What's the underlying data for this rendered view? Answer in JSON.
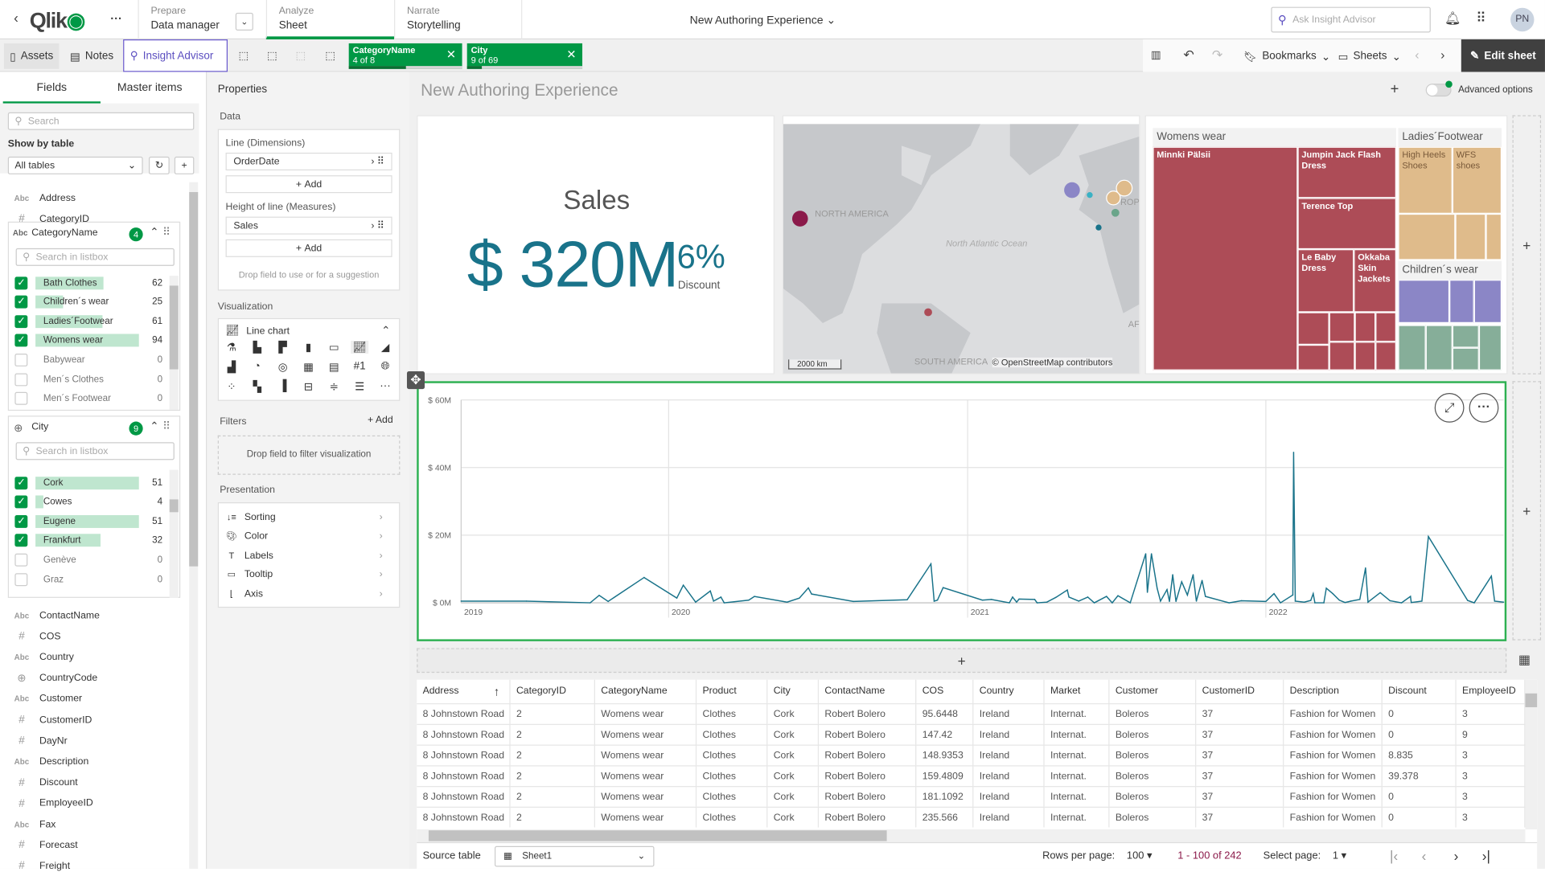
{
  "topbar": {
    "logo": "Qlik",
    "more": "···",
    "prepare": {
      "label": "Prepare",
      "value": "Data manager"
    },
    "analyze": {
      "label": "Analyze",
      "value": "Sheet"
    },
    "narrate": {
      "label": "Narrate",
      "value": "Storytelling"
    },
    "app_title": "New Authoring Experience",
    "search_placeholder": "Ask Insight Advisor",
    "avatar": "PN"
  },
  "toolbar": {
    "assets": "Assets",
    "notes": "Notes",
    "insight_advisor": "Insight Advisor",
    "selections": [
      {
        "field": "CategoryName",
        "count": "4 of 8",
        "fraction": 0.5
      },
      {
        "field": "City",
        "count": "9 of 69",
        "fraction": 0.13
      }
    ],
    "bookmarks": "Bookmarks",
    "sheets": "Sheets",
    "edit_sheet": "Edit sheet"
  },
  "left": {
    "tabs": [
      "Fields",
      "Master items"
    ],
    "search_placeholder": "Search",
    "show_by_table": "Show by table",
    "table_select": "All tables",
    "fields_top": [
      {
        "type": "Abc",
        "name": "Address"
      },
      {
        "type": "#",
        "name": "CategoryID"
      }
    ],
    "listbox_category": {
      "type": "Abc",
      "name": "CategoryName",
      "badge": "4",
      "search_placeholder": "Search in listbox",
      "items": [
        {
          "name": "Bath Clothes",
          "count": "62",
          "selected": true,
          "share": 0.66
        },
        {
          "name": "Children´s wear",
          "count": "25",
          "selected": true,
          "share": 0.27
        },
        {
          "name": "Ladies´Footwear",
          "count": "61",
          "selected": true,
          "share": 0.65
        },
        {
          "name": "Womens wear",
          "count": "94",
          "selected": true,
          "share": 1
        },
        {
          "name": "Babywear",
          "count": "0",
          "selected": false,
          "share": 0
        },
        {
          "name": "Men´s Clothes",
          "count": "0",
          "selected": false,
          "share": 0
        },
        {
          "name": "Men´s Footwear",
          "count": "0",
          "selected": false,
          "share": 0
        }
      ]
    },
    "listbox_city": {
      "name": "City",
      "badge": "9",
      "search_placeholder": "Search in listbox",
      "items": [
        {
          "name": "Cork",
          "count": "51",
          "selected": true,
          "share": 1
        },
        {
          "name": "Cowes",
          "count": "4",
          "selected": true,
          "share": 0.08
        },
        {
          "name": "Eugene",
          "count": "51",
          "selected": true,
          "share": 1
        },
        {
          "name": "Frankfurt",
          "count": "32",
          "selected": true,
          "share": 0.63
        },
        {
          "name": "Genève",
          "count": "0",
          "selected": false,
          "share": 0
        },
        {
          "name": "Graz",
          "count": "0",
          "selected": false,
          "share": 0
        }
      ]
    },
    "fields_bottom": [
      {
        "type": "Abc",
        "name": "ContactName"
      },
      {
        "type": "#",
        "name": "COS"
      },
      {
        "type": "Abc",
        "name": "Country"
      },
      {
        "type": "globe",
        "name": "CountryCode"
      },
      {
        "type": "Abc",
        "name": "Customer"
      },
      {
        "type": "#",
        "name": "CustomerID"
      },
      {
        "type": "#",
        "name": "DayNr"
      },
      {
        "type": "Abc",
        "name": "Description"
      },
      {
        "type": "#",
        "name": "Discount"
      },
      {
        "type": "#",
        "name": "EmployeeID"
      },
      {
        "type": "Abc",
        "name": "Fax"
      },
      {
        "type": "#",
        "name": "Forecast"
      },
      {
        "type": "#",
        "name": "Freight"
      }
    ]
  },
  "properties": {
    "title": "Properties",
    "data": "Data",
    "dim_label": "Line (Dimensions)",
    "dimension": "OrderDate",
    "add": "Add",
    "meas_label": "Height of line (Measures)",
    "measure": "Sales",
    "drop_hint": "Drop field to use or for a suggestion",
    "visualization": "Visualization",
    "chart_type": "Line chart",
    "kpi_icon_text": "#1",
    "filters": "Filters",
    "filters_add": "Add",
    "filters_drop": "Drop field to filter visualization",
    "presentation": "Presentation",
    "pres_items": [
      "Sorting",
      "Color",
      "Labels",
      "Tooltip",
      "Axis"
    ]
  },
  "sheet": {
    "title": "New Authoring Experience",
    "advanced_options": "Advanced options"
  },
  "kpi": {
    "title": "Sales",
    "value": "$ 320M",
    "secondary_value": "6%",
    "secondary_label": "Discount"
  },
  "map": {
    "labels": {
      "na": "NORTH AMERICA",
      "ocean": "North Atlantic Ocean",
      "eu": "ROP",
      "af": "AF",
      "sa": "SOUTH AMERICA"
    },
    "scale": "2000 km",
    "attribution": "© OpenStreetMap contributors"
  },
  "treemap": {
    "groups": [
      {
        "name": "Womens wear",
        "color": "#ad4c57",
        "items": [
          "Minnki Pälsii",
          "Jumpin Jack Flash Dress",
          "Terence Top",
          "Le Baby Dress",
          "Okkaba Skin Jackets"
        ]
      },
      {
        "name": "Ladies´Footwear",
        "color": "#dfbb8b",
        "items": [
          "High Heels Shoes",
          "WFS shoes"
        ]
      },
      {
        "name": "Children´s wear",
        "color": "#8b86c6",
        "items": []
      },
      {
        "name": "",
        "color": "#86ae99",
        "items": []
      }
    ]
  },
  "chart_data": {
    "type": "line",
    "xlabel": "",
    "ylabel": "",
    "x_ticks": [
      "2019",
      "2020",
      "2021",
      "2022"
    ],
    "y_ticks": [
      "$ 0M",
      "$ 20M",
      "$ 40M",
      "$ 60M"
    ],
    "ylim": [
      0,
      60
    ],
    "xlim": [
      "2019-04-22",
      "2022-10-19"
    ],
    "grid": true,
    "color": "#19738a",
    "points": [
      [
        "2019-04-22",
        0.5
      ],
      [
        "2019-07-11",
        0.5
      ],
      [
        "2019-09-27",
        0
      ],
      [
        "2019-10-08",
        2.2
      ],
      [
        "2019-10-19",
        0.4
      ],
      [
        "2019-12-02",
        7.5
      ],
      [
        "2020-01-11",
        1.4
      ],
      [
        "2020-01-19",
        5.2
      ],
      [
        "2020-02-03",
        0.2
      ],
      [
        "2020-02-21",
        3.5
      ],
      [
        "2020-02-25",
        0.5
      ],
      [
        "2020-03-05",
        1.7
      ],
      [
        "2020-03-09",
        0
      ],
      [
        "2020-04-08",
        0.8
      ],
      [
        "2020-04-15",
        1.9
      ],
      [
        "2020-05-25",
        0.2
      ],
      [
        "2020-06-09",
        1.4
      ],
      [
        "2020-06-20",
        4.4
      ],
      [
        "2020-06-24",
        2.6
      ],
      [
        "2020-08-14",
        0.4
      ],
      [
        "2020-10-19",
        0.9
      ],
      [
        "2020-11-17",
        11.5
      ],
      [
        "2020-11-21",
        0.5
      ],
      [
        "2020-11-25",
        0.8
      ],
      [
        "2020-12-02",
        4.5
      ],
      [
        "2021-01-19",
        0.8
      ],
      [
        "2021-01-30",
        1.0
      ],
      [
        "2021-02-21",
        0
      ],
      [
        "2021-02-25",
        1.7
      ],
      [
        "2021-03-02",
        0.2
      ],
      [
        "2021-03-05",
        1.1
      ],
      [
        "2021-03-24",
        1.0
      ],
      [
        "2021-03-27",
        0
      ],
      [
        "2021-04-08",
        0.2
      ],
      [
        "2021-04-19",
        1.6
      ],
      [
        "2021-05-03",
        3.8
      ],
      [
        "2021-05-05",
        1.7
      ],
      [
        "2021-05-17",
        0.5
      ],
      [
        "2021-05-28",
        1.7
      ],
      [
        "2021-06-05",
        0
      ],
      [
        "2021-06-20",
        1.9
      ],
      [
        "2021-06-27",
        0
      ],
      [
        "2021-07-04",
        2.1
      ],
      [
        "2021-07-19",
        0
      ],
      [
        "2021-08-07",
        14.5
      ],
      [
        "2021-08-09",
        3.1
      ],
      [
        "2021-08-14",
        14.5
      ],
      [
        "2021-08-21",
        4.3
      ],
      [
        "2021-08-25",
        0.5
      ],
      [
        "2021-09-02",
        3.9
      ],
      [
        "2021-09-05",
        0.4
      ],
      [
        "2021-09-09",
        8.3
      ],
      [
        "2021-09-13",
        0.4
      ],
      [
        "2021-09-20",
        6.2
      ],
      [
        "2021-09-27",
        2.3
      ],
      [
        "2021-10-04",
        8.3
      ],
      [
        "2021-10-08",
        0.5
      ],
      [
        "2021-10-15",
        6.6
      ],
      [
        "2021-10-19",
        1.9
      ],
      [
        "2021-11-17",
        0
      ],
      [
        "2021-12-02",
        0.6
      ],
      [
        "2022-01-01",
        0.4
      ],
      [
        "2022-01-11",
        2.7
      ],
      [
        "2022-01-19",
        0
      ],
      [
        "2022-02-03",
        2.3
      ],
      [
        "2022-02-04",
        44.5
      ],
      [
        "2022-02-06",
        0.5
      ],
      [
        "2022-02-17",
        0.2
      ],
      [
        "2022-02-25",
        0.7
      ],
      [
        "2022-02-28",
        2.7
      ],
      [
        "2022-03-02",
        0
      ],
      [
        "2022-03-13",
        0
      ],
      [
        "2022-03-16",
        4.3
      ],
      [
        "2022-03-24",
        2.7
      ],
      [
        "2022-04-01",
        0.8
      ],
      [
        "2022-04-08",
        0.1
      ],
      [
        "2022-04-15",
        0.5
      ],
      [
        "2022-04-26",
        1.0
      ],
      [
        "2022-05-03",
        10.3
      ],
      [
        "2022-05-06",
        0.2
      ],
      [
        "2022-05-21",
        3.0
      ],
      [
        "2022-06-02",
        0.6
      ],
      [
        "2022-06-16",
        0
      ],
      [
        "2022-06-27",
        1.9
      ],
      [
        "2022-06-28",
        0.1
      ],
      [
        "2022-07-11",
        0.5
      ],
      [
        "2022-07-19",
        19.6
      ],
      [
        "2022-09-05",
        0.7
      ],
      [
        "2022-09-13",
        0
      ],
      [
        "2022-10-04",
        7.9
      ],
      [
        "2022-10-08",
        0.5
      ],
      [
        "2022-10-19",
        0.2
      ]
    ]
  },
  "table": {
    "columns": [
      "Address",
      "CategoryID",
      "CategoryName",
      "Product",
      "City",
      "ContactName",
      "COS",
      "Country",
      "Market",
      "Customer",
      "CustomerID",
      "Description",
      "Discount",
      "EmployeeID"
    ],
    "rows": [
      [
        "8 Johnstown Road",
        "2",
        "Womens wear",
        "Clothes",
        "Cork",
        "Robert Bolero",
        "95.6448",
        "Ireland",
        "Internat.",
        "Boleros",
        "37",
        "Fashion for Women",
        "0",
        "3"
      ],
      [
        "8 Johnstown Road",
        "2",
        "Womens wear",
        "Clothes",
        "Cork",
        "Robert Bolero",
        "147.42",
        "Ireland",
        "Internat.",
        "Boleros",
        "37",
        "Fashion for Women",
        "0",
        "9"
      ],
      [
        "8 Johnstown Road",
        "2",
        "Womens wear",
        "Clothes",
        "Cork",
        "Robert Bolero",
        "148.9353",
        "Ireland",
        "Internat.",
        "Boleros",
        "37",
        "Fashion for Women",
        "8.835",
        "3"
      ],
      [
        "8 Johnstown Road",
        "2",
        "Womens wear",
        "Clothes",
        "Cork",
        "Robert Bolero",
        "159.4809",
        "Ireland",
        "Internat.",
        "Boleros",
        "37",
        "Fashion for Women",
        "39.378",
        "3"
      ],
      [
        "8 Johnstown Road",
        "2",
        "Womens wear",
        "Clothes",
        "Cork",
        "Robert Bolero",
        "181.1092",
        "Ireland",
        "Internat.",
        "Boleros",
        "37",
        "Fashion for Women",
        "0",
        "3"
      ],
      [
        "8 Johnstown Road",
        "2",
        "Womens wear",
        "Clothes",
        "Cork",
        "Robert Bolero",
        "235.566",
        "Ireland",
        "Internat.",
        "Boleros",
        "37",
        "Fashion for Women",
        "0",
        "3"
      ]
    ],
    "source_label": "Source table",
    "source_value": "Sheet1",
    "rows_per_page_label": "Rows per page:",
    "rows_per_page": "100",
    "range": "1 - 100 of 242",
    "select_page_label": "Select page:",
    "page": "1"
  }
}
